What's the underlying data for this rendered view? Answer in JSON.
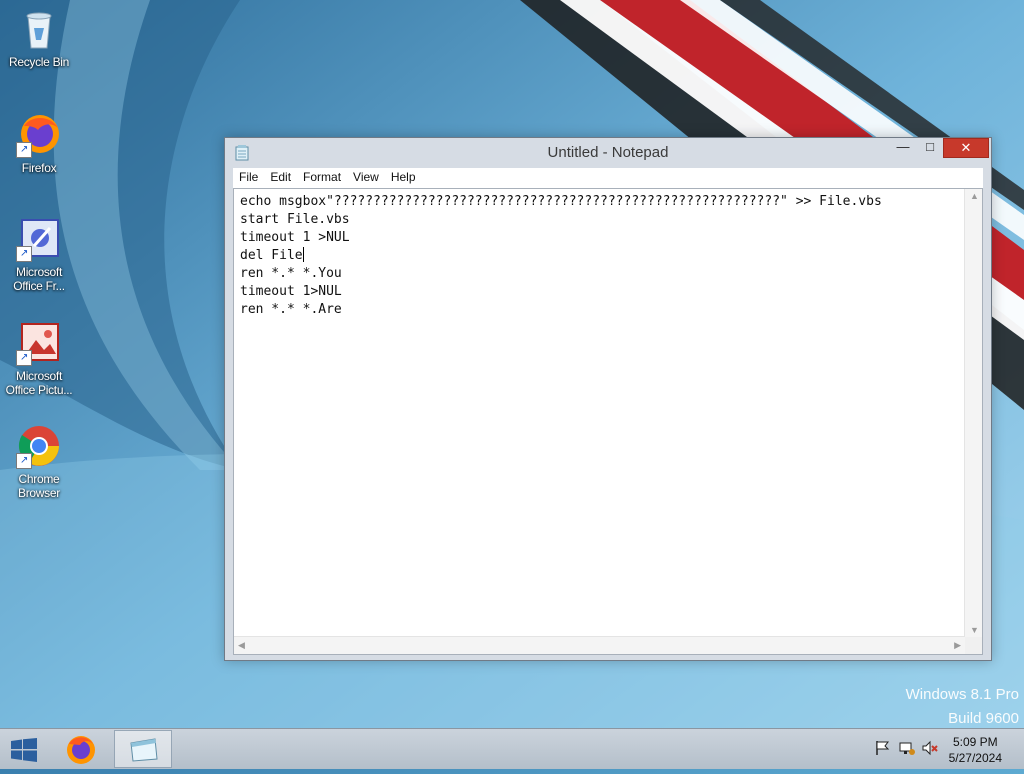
{
  "desktop": {
    "icons": [
      {
        "label": "Recycle Bin",
        "icon": "recycle-bin-icon"
      },
      {
        "label": "Firefox",
        "icon": "firefox-icon"
      },
      {
        "label": "Microsoft Office Fr...",
        "icon": "office-frontpage-icon"
      },
      {
        "label": "Microsoft Office Pictu...",
        "icon": "office-picture-manager-icon"
      },
      {
        "label": "Chrome Browser",
        "icon": "chrome-icon"
      }
    ],
    "watermark": {
      "line1": "Windows 8.1 Pro",
      "line2": "Build 9600"
    }
  },
  "window": {
    "title": "Untitled - Notepad",
    "menu": [
      "File",
      "Edit",
      "Format",
      "View",
      "Help"
    ],
    "lines": [
      "echo msgbox\"?????????????????????????????????????????????????????????\" >> File.vbs",
      "start File.vbs",
      "timeout 1 >NUL",
      "del File",
      "ren *.* *.You",
      "timeout 1>NUL",
      "ren *.* *.Are"
    ]
  },
  "taskbar": {
    "clock_time": "5:09 PM",
    "clock_date": "5/27/2024"
  },
  "colors": {
    "close_button": "#c7392b",
    "title_text": "#3a3a3a"
  }
}
